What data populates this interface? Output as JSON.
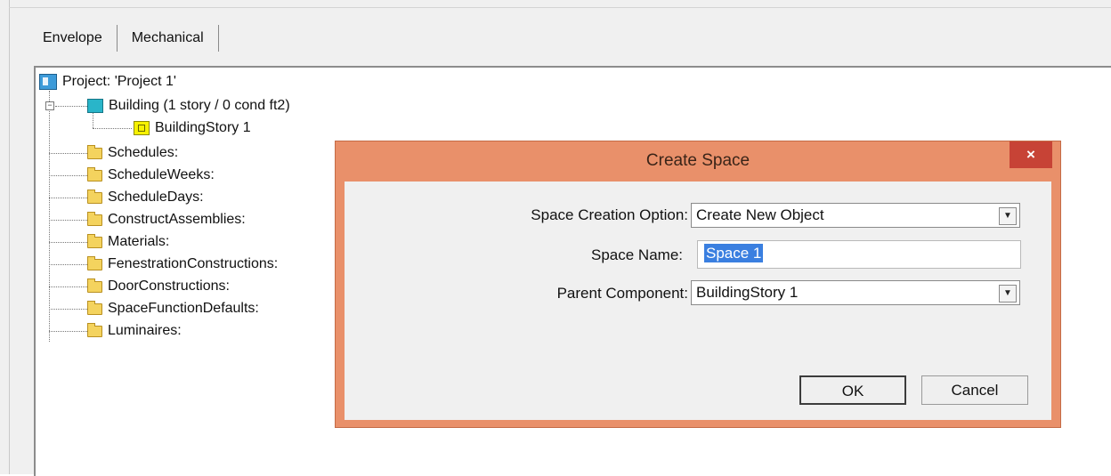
{
  "tabs": [
    {
      "label": "Envelope"
    },
    {
      "label": "Mechanical"
    }
  ],
  "tree": {
    "project": "Project:  'Project 1'",
    "building": "Building  (1 story / 0 cond ft2)",
    "story": "BuildingStory 1",
    "folders": [
      "Schedules:",
      "ScheduleWeeks:",
      "ScheduleDays:",
      "ConstructAssemblies:",
      "Materials:",
      "FenestrationConstructions:",
      "DoorConstructions:",
      "SpaceFunctionDefaults:",
      "Luminaires:"
    ]
  },
  "dialog": {
    "title": "Create Space",
    "close_label": "×",
    "option_label": "Space Creation Option:",
    "option_value": "Create New Object",
    "name_label": "Space Name:",
    "name_value": "Space 1",
    "parent_label": "Parent Component:",
    "parent_value": "BuildingStory 1",
    "ok_label": "OK",
    "cancel_label": "Cancel",
    "dropdown_glyph": "▼",
    "accent_color": "#e9906a",
    "close_color": "#c74336"
  }
}
